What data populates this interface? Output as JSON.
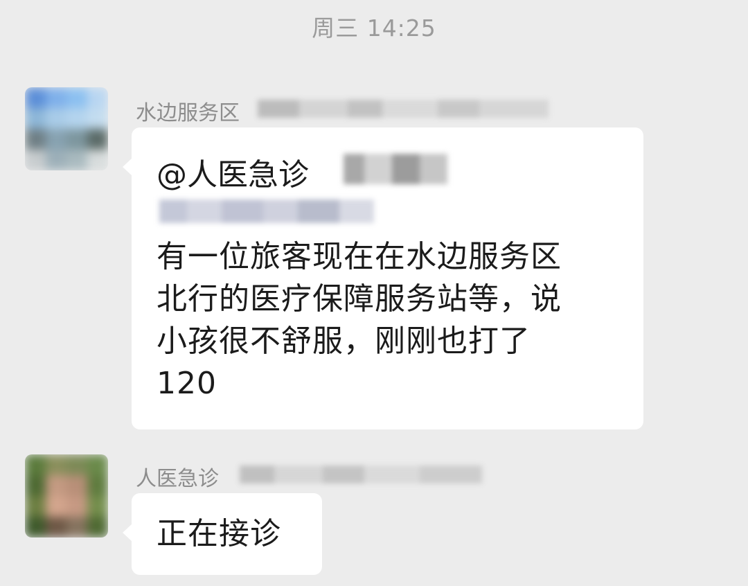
{
  "timestamp": "周三 14:25",
  "messages": [
    {
      "sender": "水边服务区",
      "mention": "@人医急诊",
      "lines": [
        "有一位旅客现在在水边服务区",
        "北行的医疗保障服务站等，说",
        "小孩很不舒服，刚刚也打了",
        "120"
      ]
    },
    {
      "sender": "人医急诊",
      "text": "正在接诊"
    }
  ],
  "colors": {
    "background": "#ececec",
    "bubble": "#ffffff",
    "name_text": "#8d8d8d",
    "message_text": "#1b1b1b"
  }
}
